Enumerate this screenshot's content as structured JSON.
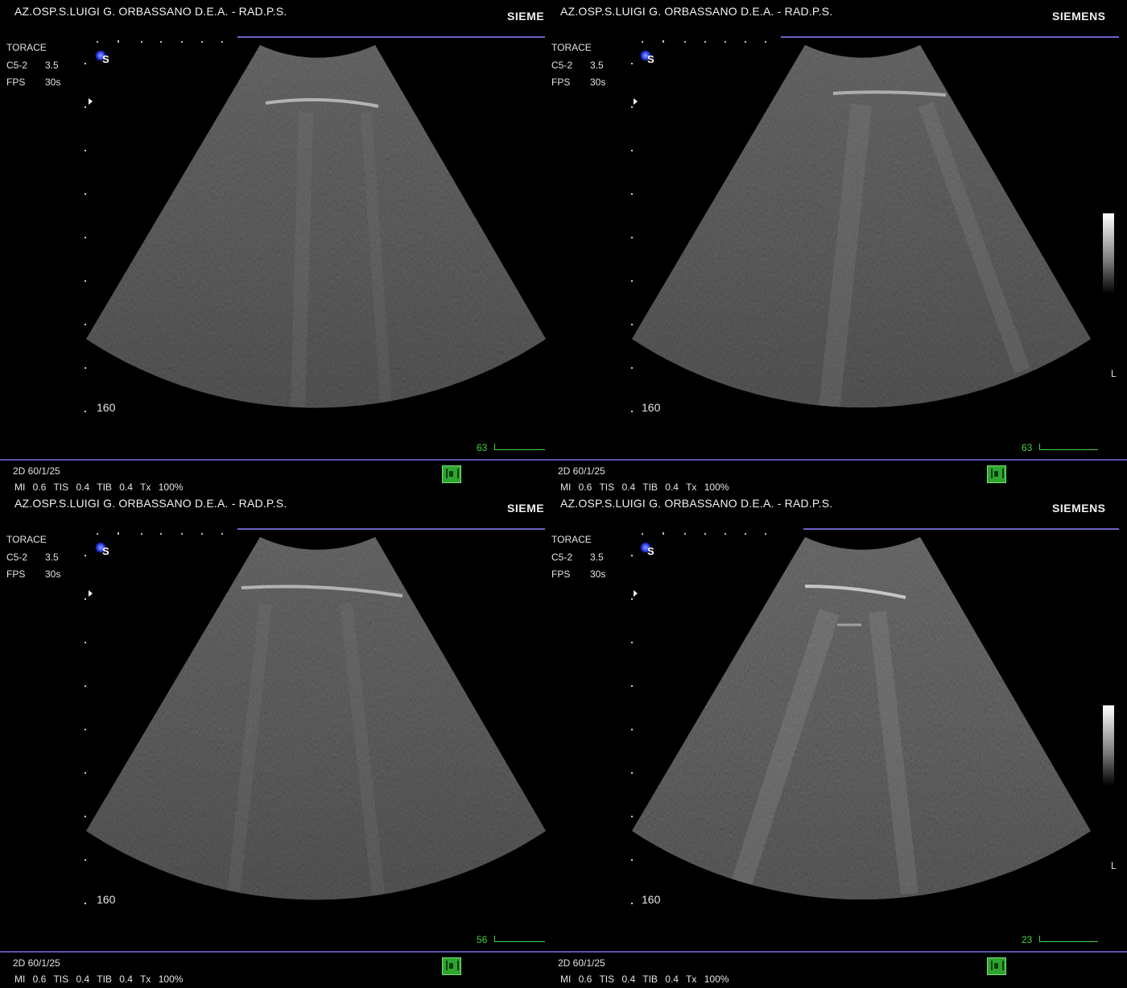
{
  "panels": [
    {
      "header": "AZ.OSP.S.LUIGI G. ORBASSANO D.E.A. - RAD.P.S.",
      "brand": "SIEME",
      "preset": "TORACE",
      "probe": {
        "label": "C5-2",
        "value": "3.5"
      },
      "fps": {
        "label": "FPS",
        "value": "30s"
      },
      "depth": "160",
      "gain": "63",
      "mode": "2D 60/1/25",
      "indices": "MI 0.6  TIS 0.4  TIB 0.4  Tx  100%",
      "show_scale": false
    },
    {
      "header": "AZ.OSP.S.LUIGI G. ORBASSANO D.E.A. - RAD.P.S.",
      "brand": "SIEMENS",
      "preset": "TORACE",
      "probe": {
        "label": "C5-2",
        "value": "3.5"
      },
      "fps": {
        "label": "FPS",
        "value": "30s"
      },
      "depth": "160",
      "gain": "63",
      "mode": "2D 60/1/25",
      "indices": "MI 0.6  TIS 0.4  TIB 0.4  Tx  100%",
      "show_scale": true,
      "side_label": "L"
    },
    {
      "header": "AZ.OSP.S.LUIGI G. ORBASSANO D.E.A. - RAD.P.S.",
      "brand": "SIEME",
      "preset": "TORACE",
      "probe": {
        "label": "C5-2",
        "value": "3.5"
      },
      "fps": {
        "label": "FPS",
        "value": "30s"
      },
      "depth": "160",
      "gain": "56",
      "mode": "2D 60/1/25",
      "indices": "MI 0.6  TIS 0.4  TIB 0.4  Tx  100%",
      "show_scale": false
    },
    {
      "header": "AZ.OSP.S.LUIGI G. ORBASSANO D.E.A. - RAD.P.S.",
      "brand": "SIEMENS",
      "preset": "TORACE",
      "probe": {
        "label": "C5-2",
        "value": "3.5"
      },
      "fps": {
        "label": "FPS",
        "value": "30s"
      },
      "depth": "160",
      "gain": "23",
      "mode": "2D 60/1/25",
      "indices": "MI 0.6  TIS 0.4  TIB 0.4  Tx  100%",
      "show_scale": true,
      "side_label": "L"
    }
  ],
  "colors": {
    "accent_rule": "#6b63c9",
    "gain_green": "#3fd23f",
    "background": "#000000"
  },
  "icons": [
    "siemens-logo-icon",
    "cine-film-icon",
    "focus-marker-icon"
  ]
}
